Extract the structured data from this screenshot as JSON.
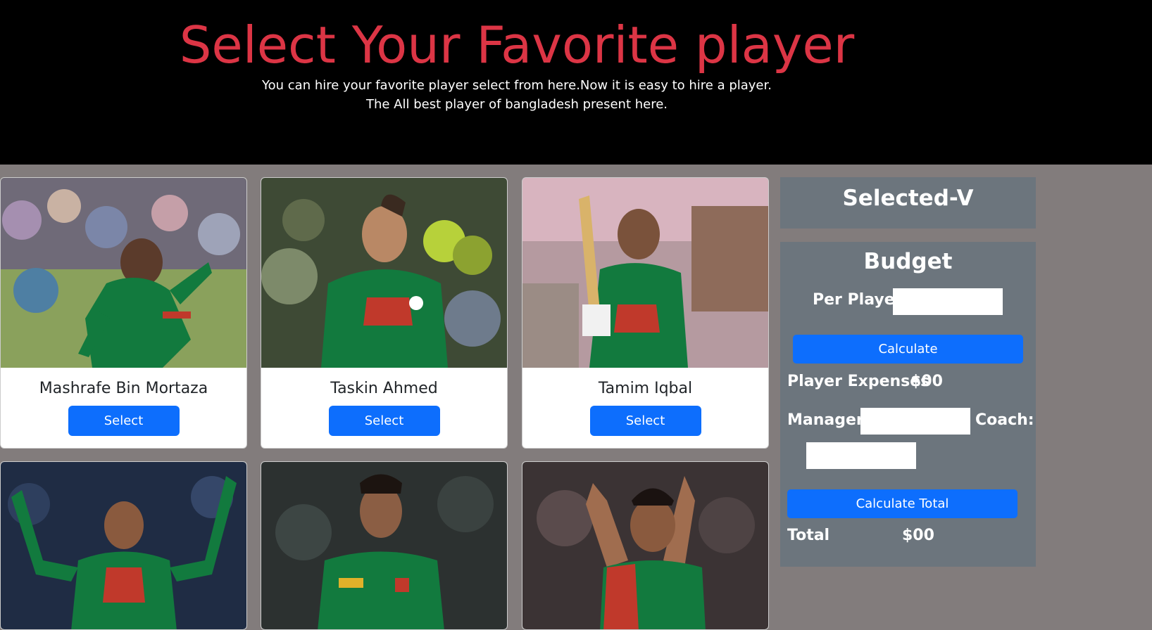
{
  "header": {
    "title": "Select Your Favorite player",
    "subtitle_line1": "You can hire your favorite player select from here.Now it is easy to hire a player.",
    "subtitle_line2": "The All best player of bangladesh present here."
  },
  "players": [
    {
      "name": "Mashrafe Bin Mortaza",
      "select_label": "Select"
    },
    {
      "name": "Taskin Ahmed",
      "select_label": "Select"
    },
    {
      "name": "Tamim Iqbal",
      "select_label": "Select"
    },
    {
      "name": "",
      "select_label": ""
    },
    {
      "name": "",
      "select_label": ""
    },
    {
      "name": "",
      "select_label": ""
    }
  ],
  "selected_panel": {
    "title": "Selected-V"
  },
  "budget": {
    "title": "Budget",
    "per_player_label": "Per Player:",
    "per_player_value": "",
    "calculate_label": "Calculate",
    "player_expenses_label": "Player Expenses",
    "player_expenses_value": "$00",
    "manager_label": "Manager:",
    "manager_value": "",
    "coach_label": "Coach:",
    "coach_value": "",
    "calculate_total_label": "Calculate Total",
    "total_label": "Total",
    "total_value": "$00"
  },
  "colors": {
    "accent": "#0d6efd",
    "title_red": "#dc3545",
    "panel_gray": "#6c757d",
    "page_bg": "#827c7c"
  }
}
